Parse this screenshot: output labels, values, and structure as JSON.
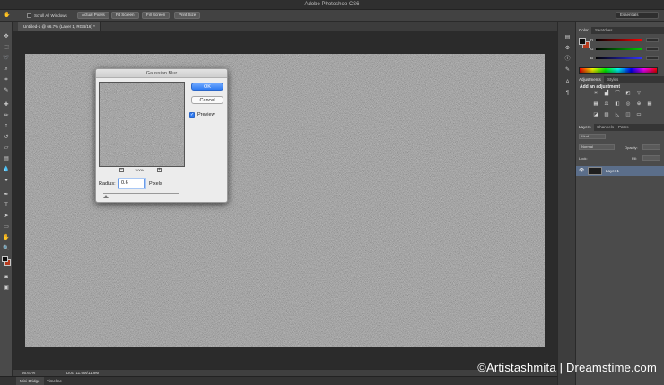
{
  "window": {
    "title": "Adobe Photoshop CS6"
  },
  "options_bar": {
    "scroll_all_windows": "Scroll All Windows",
    "buttons": [
      "Actual Pixels",
      "Fit Screen",
      "Fill Screen",
      "Print Size"
    ],
    "workspace": "Essentials"
  },
  "document": {
    "tab_label": "Untitled-1 @ 66.7% (Layer 1, RGB/16) *"
  },
  "status": {
    "zoom": "66.67%",
    "doc_size": "Doc: 11.9M/11.9M"
  },
  "bottom_tabs": [
    "Mini Bridge",
    "Timeline"
  ],
  "panels": {
    "color": {
      "tabs": [
        "Color",
        "Swatches"
      ],
      "channels": [
        "R",
        "G",
        "B"
      ],
      "fg_color": "#0e0e0e",
      "bg_color": "#b63a1d"
    },
    "adjustments": {
      "tabs": [
        "Adjustments",
        "Styles"
      ],
      "heading": "Add an adjustment"
    },
    "layers": {
      "tabs": [
        "Layers",
        "Channels",
        "Paths"
      ],
      "kind_filter": "Kind",
      "blend_mode": "Normal",
      "opacity_label": "Opacity:",
      "lock_label": "Lock:",
      "fill_label": "Fill:",
      "layers": [
        {
          "name": "Layer 1"
        }
      ]
    }
  },
  "dialog": {
    "title": "Gaussian Blur",
    "ok_label": "OK",
    "cancel_label": "Cancel",
    "preview_label": "Preview",
    "preview_checked": true,
    "zoom": "100%",
    "radius_label": "Radius:",
    "radius_value": "0.6",
    "radius_unit": "Pixels"
  },
  "watermark": "©Artistashmita | Dreamstime.com"
}
